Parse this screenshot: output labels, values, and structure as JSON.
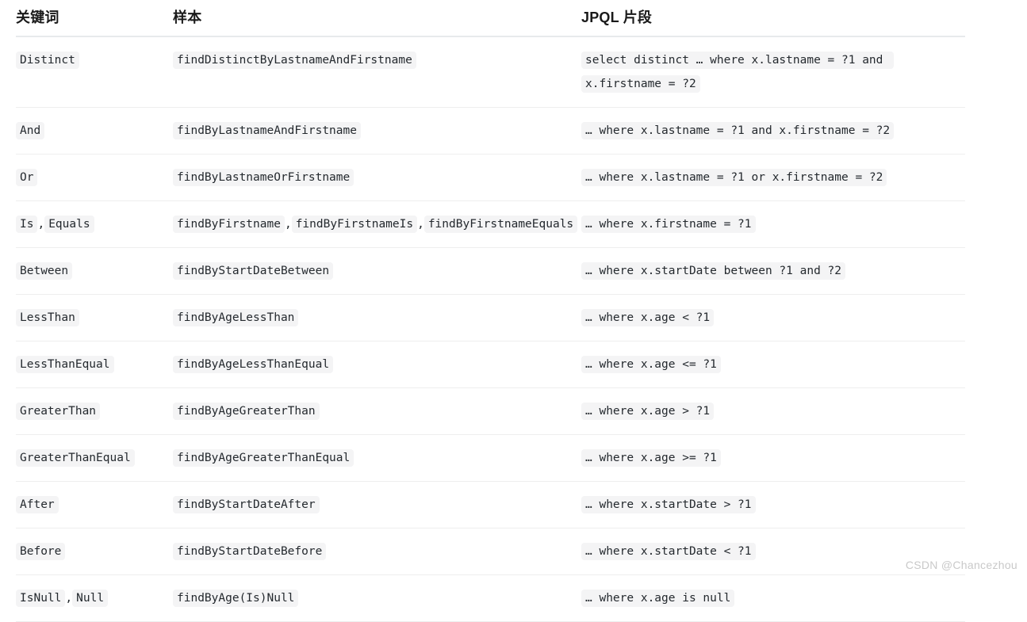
{
  "table": {
    "headers": {
      "keyword": "关键词",
      "sample": "样本",
      "jpql": "JPQL 片段"
    },
    "rows": [
      {
        "keyword": [
          "Distinct"
        ],
        "sample": [
          "findDistinctByLastnameAndFirstname"
        ],
        "jpql": [
          "select distinct … where x.lastname = ?1 and x.firstname = ?2"
        ]
      },
      {
        "keyword": [
          "And"
        ],
        "sample": [
          "findByLastnameAndFirstname"
        ],
        "jpql": [
          "… where x.lastname = ?1 and x.firstname = ?2"
        ]
      },
      {
        "keyword": [
          "Or"
        ],
        "sample": [
          "findByLastnameOrFirstname"
        ],
        "jpql": [
          "… where x.lastname = ?1 or x.firstname = ?2"
        ]
      },
      {
        "keyword": [
          "Is",
          "Equals"
        ],
        "sample": [
          "findByFirstname",
          "findByFirstnameIs",
          "findByFirstnameEquals"
        ],
        "jpql": [
          "… where x.firstname = ?1"
        ]
      },
      {
        "keyword": [
          "Between"
        ],
        "sample": [
          "findByStartDateBetween"
        ],
        "jpql": [
          "… where x.startDate between ?1 and ?2"
        ]
      },
      {
        "keyword": [
          "LessThan"
        ],
        "sample": [
          "findByAgeLessThan"
        ],
        "jpql": [
          "… where x.age < ?1"
        ]
      },
      {
        "keyword": [
          "LessThanEqual"
        ],
        "sample": [
          "findByAgeLessThanEqual"
        ],
        "jpql": [
          "… where x.age <= ?1"
        ]
      },
      {
        "keyword": [
          "GreaterThan"
        ],
        "sample": [
          "findByAgeGreaterThan"
        ],
        "jpql": [
          "… where x.age > ?1"
        ]
      },
      {
        "keyword": [
          "GreaterThanEqual"
        ],
        "sample": [
          "findByAgeGreaterThanEqual"
        ],
        "jpql": [
          "… where x.age >= ?1"
        ]
      },
      {
        "keyword": [
          "After"
        ],
        "sample": [
          "findByStartDateAfter"
        ],
        "jpql": [
          "… where x.startDate > ?1"
        ]
      },
      {
        "keyword": [
          "Before"
        ],
        "sample": [
          "findByStartDateBefore"
        ],
        "jpql": [
          "… where x.startDate < ?1"
        ]
      },
      {
        "keyword": [
          "IsNull",
          "Null"
        ],
        "sample": [
          "findByAge(Is)Null"
        ],
        "jpql": [
          "… where x.age is null"
        ]
      }
    ],
    "separator": ","
  },
  "watermark": "CSDN @Chancezhou",
  "colors": {
    "chip_background": "#f4f4f5",
    "chip_text": "#24292e",
    "header_text": "#1a1a1a",
    "header_rule": "#e7eaec",
    "row_rule": "#eeeeee",
    "watermark_text": "#c9c9c9"
  }
}
